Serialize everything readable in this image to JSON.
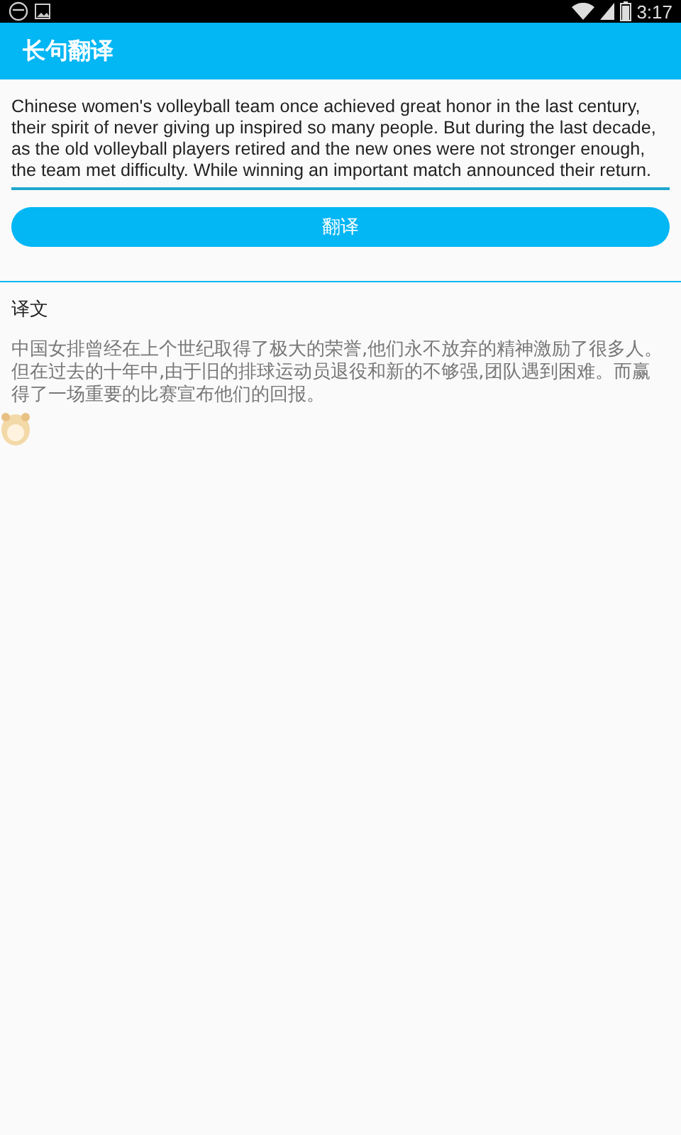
{
  "status_bar": {
    "time": "3:17"
  },
  "app_bar": {
    "title": "长句翻译"
  },
  "source": {
    "value": "Chinese women's volleyball team once achieved great honor in the last century, their spirit of never giving up inspired so many people. But during the last decade, as the old volleyball players retired and the new ones were not stronger enough, the team met difficulty. While winning an important match announced their return."
  },
  "translate_button": {
    "label": "翻译"
  },
  "result": {
    "heading": "译文",
    "text": "中国女排曾经在上个世纪取得了极大的荣誉,他们永不放弃的精神激励了很多人。但在过去的十年中,由于旧的排球运动员退役和新的不够强,团队遇到困难。而赢得了一场重要的比赛宣布他们的回报。"
  }
}
